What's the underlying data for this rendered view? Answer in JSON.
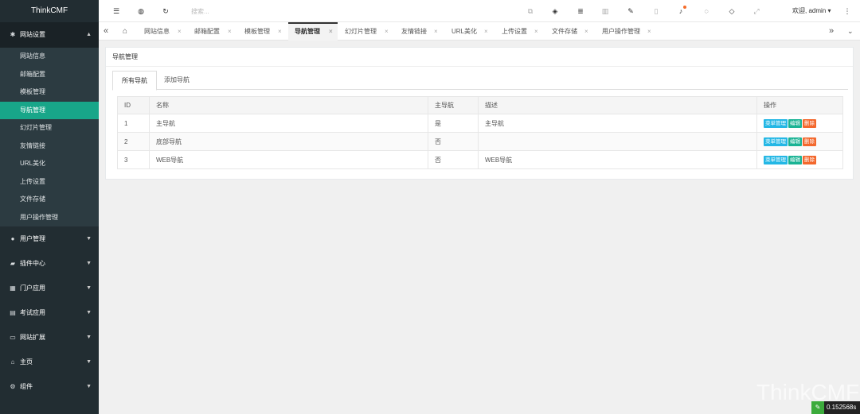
{
  "brand": "ThinkCMF",
  "sidebar": {
    "open_menu": {
      "label": "网站设置",
      "icon": "gears-icon"
    },
    "sub_items": [
      {
        "label": "网站信息",
        "active": false
      },
      {
        "label": "邮箱配置",
        "active": false
      },
      {
        "label": "模板管理",
        "active": false
      },
      {
        "label": "导航管理",
        "active": true
      },
      {
        "label": "幻灯片管理",
        "active": false
      },
      {
        "label": "友情链接",
        "active": false
      },
      {
        "label": "URL美化",
        "active": false
      },
      {
        "label": "上传设置",
        "active": false
      },
      {
        "label": "文件存储",
        "active": false
      },
      {
        "label": "用户操作管理",
        "active": false
      }
    ],
    "menus": [
      {
        "label": "用户管理",
        "icon": "users-icon"
      },
      {
        "label": "插件中心",
        "icon": "plug-icon"
      },
      {
        "label": "门户应用",
        "icon": "grid-icon"
      },
      {
        "label": "考试应用",
        "icon": "file-icon"
      },
      {
        "label": "网站扩展",
        "icon": "monitor-icon"
      },
      {
        "label": "主页",
        "icon": "home-icon"
      },
      {
        "label": "组件",
        "icon": "gear-icon"
      }
    ]
  },
  "topbar": {
    "search_placeholder": "搜索...",
    "welcome": "欢迎, admin"
  },
  "tabs": [
    {
      "label": "网站信息"
    },
    {
      "label": "邮箱配置"
    },
    {
      "label": "模板管理"
    },
    {
      "label": "导航管理"
    },
    {
      "label": "幻灯片管理"
    },
    {
      "label": "友情链接"
    },
    {
      "label": "URL美化"
    },
    {
      "label": "上传设置"
    },
    {
      "label": "文件存储"
    },
    {
      "label": "用户操作管理"
    }
  ],
  "panel": {
    "title": "导航管理",
    "tabs": [
      "所有导航",
      "添加导航"
    ],
    "columns": [
      "ID",
      "名称",
      "主导航",
      "描述",
      "操作"
    ],
    "rows": [
      {
        "id": "1",
        "name": "主导航",
        "main": "是",
        "desc": "主导航"
      },
      {
        "id": "2",
        "name": "底部导航",
        "main": "否",
        "desc": ""
      },
      {
        "id": "3",
        "name": "WEB导航",
        "main": "否",
        "desc": "WEB导航"
      }
    ],
    "actions": {
      "menu": "菜单管理",
      "edit": "编辑",
      "delete": "删除"
    }
  },
  "watermark": "ThinkCMF",
  "timer": "0.152568s",
  "colors": {
    "sidebar_bg": "#222d32",
    "active_green": "#18a689",
    "btn_blue": "#23b7e5",
    "btn_teal": "#1ab394",
    "btn_orange": "#f3682d"
  }
}
